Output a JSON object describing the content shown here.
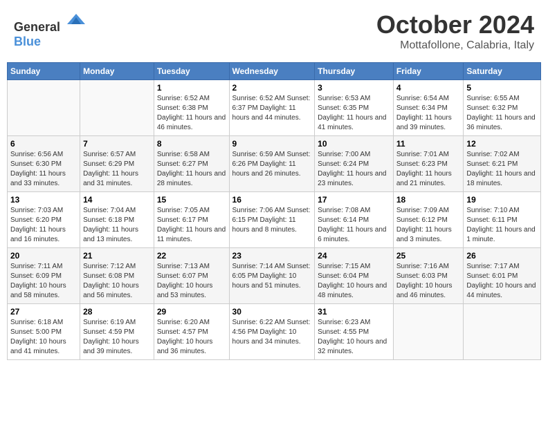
{
  "header": {
    "logo_general": "General",
    "logo_blue": "Blue",
    "month": "October 2024",
    "location": "Mottafollone, Calabria, Italy"
  },
  "columns": [
    "Sunday",
    "Monday",
    "Tuesday",
    "Wednesday",
    "Thursday",
    "Friday",
    "Saturday"
  ],
  "weeks": [
    [
      {
        "day": "",
        "info": ""
      },
      {
        "day": "",
        "info": ""
      },
      {
        "day": "1",
        "info": "Sunrise: 6:52 AM\nSunset: 6:38 PM\nDaylight: 11 hours and 46 minutes."
      },
      {
        "day": "2",
        "info": "Sunrise: 6:52 AM\nSunset: 6:37 PM\nDaylight: 11 hours and 44 minutes."
      },
      {
        "day": "3",
        "info": "Sunrise: 6:53 AM\nSunset: 6:35 PM\nDaylight: 11 hours and 41 minutes."
      },
      {
        "day": "4",
        "info": "Sunrise: 6:54 AM\nSunset: 6:34 PM\nDaylight: 11 hours and 39 minutes."
      },
      {
        "day": "5",
        "info": "Sunrise: 6:55 AM\nSunset: 6:32 PM\nDaylight: 11 hours and 36 minutes."
      }
    ],
    [
      {
        "day": "6",
        "info": "Sunrise: 6:56 AM\nSunset: 6:30 PM\nDaylight: 11 hours and 33 minutes."
      },
      {
        "day": "7",
        "info": "Sunrise: 6:57 AM\nSunset: 6:29 PM\nDaylight: 11 hours and 31 minutes."
      },
      {
        "day": "8",
        "info": "Sunrise: 6:58 AM\nSunset: 6:27 PM\nDaylight: 11 hours and 28 minutes."
      },
      {
        "day": "9",
        "info": "Sunrise: 6:59 AM\nSunset: 6:26 PM\nDaylight: 11 hours and 26 minutes."
      },
      {
        "day": "10",
        "info": "Sunrise: 7:00 AM\nSunset: 6:24 PM\nDaylight: 11 hours and 23 minutes."
      },
      {
        "day": "11",
        "info": "Sunrise: 7:01 AM\nSunset: 6:23 PM\nDaylight: 11 hours and 21 minutes."
      },
      {
        "day": "12",
        "info": "Sunrise: 7:02 AM\nSunset: 6:21 PM\nDaylight: 11 hours and 18 minutes."
      }
    ],
    [
      {
        "day": "13",
        "info": "Sunrise: 7:03 AM\nSunset: 6:20 PM\nDaylight: 11 hours and 16 minutes."
      },
      {
        "day": "14",
        "info": "Sunrise: 7:04 AM\nSunset: 6:18 PM\nDaylight: 11 hours and 13 minutes."
      },
      {
        "day": "15",
        "info": "Sunrise: 7:05 AM\nSunset: 6:17 PM\nDaylight: 11 hours and 11 minutes."
      },
      {
        "day": "16",
        "info": "Sunrise: 7:06 AM\nSunset: 6:15 PM\nDaylight: 11 hours and 8 minutes."
      },
      {
        "day": "17",
        "info": "Sunrise: 7:08 AM\nSunset: 6:14 PM\nDaylight: 11 hours and 6 minutes."
      },
      {
        "day": "18",
        "info": "Sunrise: 7:09 AM\nSunset: 6:12 PM\nDaylight: 11 hours and 3 minutes."
      },
      {
        "day": "19",
        "info": "Sunrise: 7:10 AM\nSunset: 6:11 PM\nDaylight: 11 hours and 1 minute."
      }
    ],
    [
      {
        "day": "20",
        "info": "Sunrise: 7:11 AM\nSunset: 6:09 PM\nDaylight: 10 hours and 58 minutes."
      },
      {
        "day": "21",
        "info": "Sunrise: 7:12 AM\nSunset: 6:08 PM\nDaylight: 10 hours and 56 minutes."
      },
      {
        "day": "22",
        "info": "Sunrise: 7:13 AM\nSunset: 6:07 PM\nDaylight: 10 hours and 53 minutes."
      },
      {
        "day": "23",
        "info": "Sunrise: 7:14 AM\nSunset: 6:05 PM\nDaylight: 10 hours and 51 minutes."
      },
      {
        "day": "24",
        "info": "Sunrise: 7:15 AM\nSunset: 6:04 PM\nDaylight: 10 hours and 48 minutes."
      },
      {
        "day": "25",
        "info": "Sunrise: 7:16 AM\nSunset: 6:03 PM\nDaylight: 10 hours and 46 minutes."
      },
      {
        "day": "26",
        "info": "Sunrise: 7:17 AM\nSunset: 6:01 PM\nDaylight: 10 hours and 44 minutes."
      }
    ],
    [
      {
        "day": "27",
        "info": "Sunrise: 6:18 AM\nSunset: 5:00 PM\nDaylight: 10 hours and 41 minutes."
      },
      {
        "day": "28",
        "info": "Sunrise: 6:19 AM\nSunset: 4:59 PM\nDaylight: 10 hours and 39 minutes."
      },
      {
        "day": "29",
        "info": "Sunrise: 6:20 AM\nSunset: 4:57 PM\nDaylight: 10 hours and 36 minutes."
      },
      {
        "day": "30",
        "info": "Sunrise: 6:22 AM\nSunset: 4:56 PM\nDaylight: 10 hours and 34 minutes."
      },
      {
        "day": "31",
        "info": "Sunrise: 6:23 AM\nSunset: 4:55 PM\nDaylight: 10 hours and 32 minutes."
      },
      {
        "day": "",
        "info": ""
      },
      {
        "day": "",
        "info": ""
      }
    ]
  ]
}
